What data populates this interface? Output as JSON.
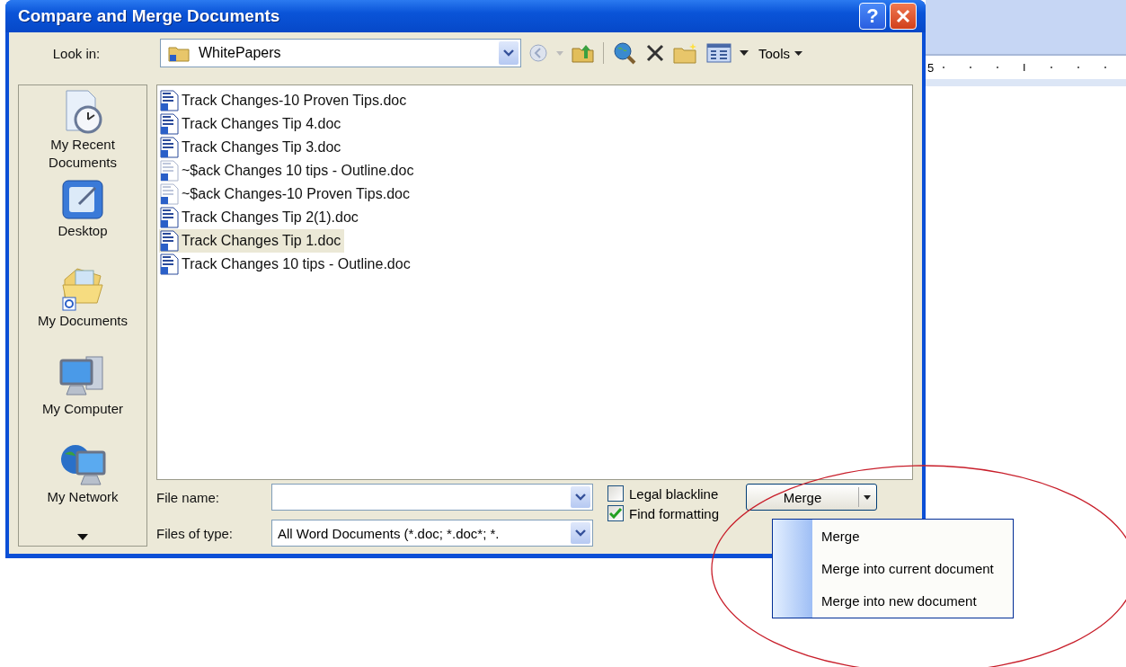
{
  "window": {
    "title": "Compare and Merge Documents",
    "help": "?"
  },
  "look_in": {
    "label": "Look in:",
    "value": "WhitePapers"
  },
  "toolbar": {
    "tools": "Tools"
  },
  "places": [
    {
      "label": "My Recent Documents",
      "kind": "recent"
    },
    {
      "label": "Desktop",
      "kind": "desktop"
    },
    {
      "label": "My Documents",
      "kind": "documents"
    },
    {
      "label": "My Computer",
      "kind": "computer"
    },
    {
      "label": "My Network",
      "kind": "network"
    }
  ],
  "files": [
    {
      "name": "Track Changes-10 Proven Tips.doc",
      "kind": "doc",
      "selected": false
    },
    {
      "name": "Track Changes Tip 4.doc",
      "kind": "doc",
      "selected": false
    },
    {
      "name": "Track Changes Tip 3.doc",
      "kind": "doc",
      "selected": false
    },
    {
      "name": "~$ack Changes 10 tips - Outline.doc",
      "kind": "temp",
      "selected": false
    },
    {
      "name": "~$ack Changes-10 Proven Tips.doc",
      "kind": "temp",
      "selected": false
    },
    {
      "name": "Track Changes Tip 2(1).doc",
      "kind": "doc",
      "selected": false
    },
    {
      "name": "Track Changes Tip 1.doc",
      "kind": "doc",
      "selected": true
    },
    {
      "name": "Track Changes 10 tips - Outline.doc",
      "kind": "doc",
      "selected": false
    }
  ],
  "file_name": {
    "label": "File name:"
  },
  "file_type": {
    "label": "Files of type:",
    "value": "All Word Documents (*.doc; *.doc*; *."
  },
  "options": [
    {
      "label": "Legal blackline",
      "checked": false
    },
    {
      "label": "Find formatting",
      "checked": true
    }
  ],
  "merge_button": {
    "label": "Merge"
  },
  "merge_menu": [
    {
      "label": "Merge"
    },
    {
      "label": "Merge into current document"
    },
    {
      "label": "Merge into new document"
    }
  ],
  "ruler": {
    "mark": "5"
  }
}
